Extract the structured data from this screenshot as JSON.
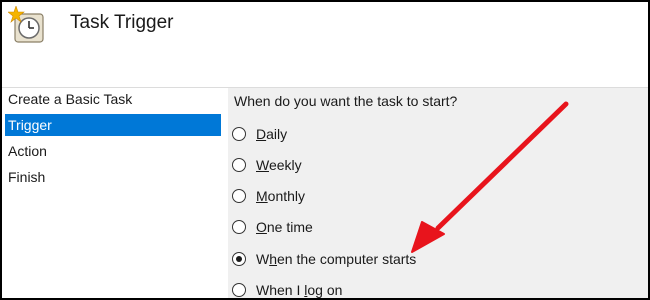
{
  "window": {
    "title": "Task Trigger",
    "icon": "task-scheduler-clock-icon"
  },
  "sidebar": {
    "items": [
      {
        "label": "Create a Basic Task",
        "active": false
      },
      {
        "label": "Trigger",
        "active": true
      },
      {
        "label": "Action",
        "active": false
      },
      {
        "label": "Finish",
        "active": false
      }
    ]
  },
  "main": {
    "prompt": "When do you want the task to start?",
    "options": [
      {
        "mnemonic": "D",
        "rest": "aily",
        "label": "Daily",
        "selected": false
      },
      {
        "mnemonic": "W",
        "rest": "eekly",
        "label": "Weekly",
        "selected": false
      },
      {
        "mnemonic": "M",
        "rest": "onthly",
        "label": "Monthly",
        "selected": false
      },
      {
        "mnemonic": "O",
        "rest": "ne time",
        "label": "One time",
        "selected": false
      },
      {
        "before": "W",
        "mnemonic": "h",
        "rest": "en the computer starts",
        "label": "When the computer starts",
        "selected": true
      },
      {
        "before": "When I ",
        "mnemonic": "l",
        "rest": "og on",
        "label": "When I log on",
        "selected": false
      }
    ]
  },
  "annotation": {
    "icon": "red-arrow-icon",
    "color": "#e8141c"
  },
  "colors": {
    "selection": "#0078d7",
    "content_bg": "#f0f0f0"
  }
}
